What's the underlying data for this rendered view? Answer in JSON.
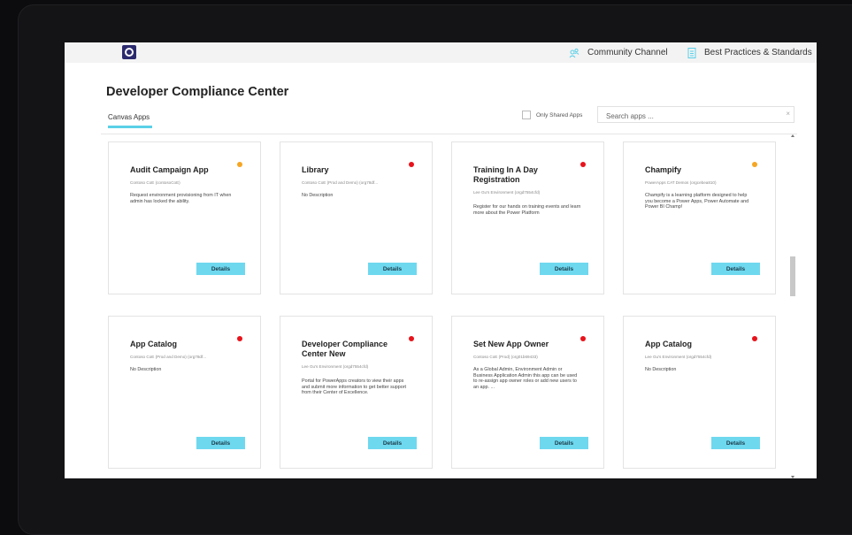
{
  "header": {
    "community_label": "Community Channel",
    "best_practices_label": "Best Practices & Standards"
  },
  "page": {
    "title": "Developer Compliance Center"
  },
  "tabs": [
    {
      "label": "Canvas Apps",
      "selected": true
    }
  ],
  "filters": {
    "only_shared_label": "Only Shared Apps",
    "only_shared_checked": false
  },
  "search": {
    "placeholder": "Search apps ...",
    "clear": "×"
  },
  "colors": {
    "accent": "#6ed8ef",
    "status_orange": "#f5a623",
    "status_red": "#e8131b"
  },
  "cards": [
    {
      "title": "Audit Campaign App",
      "environment": "Contoso CoE (contosoCoE)",
      "description": "Request environment provisioning from IT when admin has locked the ability.",
      "status": "orange",
      "details_label": "Details"
    },
    {
      "title": "Library",
      "environment": "Contoso CoE (Prod and Demo) (org78df...",
      "description": "No Description",
      "status": "red",
      "details_label": "Details"
    },
    {
      "title": "Training In A Day Registration",
      "environment": "Lee Gu's Environment (orgd7554cfd)",
      "description": "Register for our hands on training events and learn more about the Power Platform",
      "status": "red",
      "details_label": "Details"
    },
    {
      "title": "Champify",
      "environment": "PowerApps CAT Demos (orgcebea810)",
      "description": "Champify is a learning platform designed to help you become a Power Apps, Power Automate and Power BI Champ!",
      "status": "orange",
      "details_label": "Details"
    },
    {
      "title": "App Catalog",
      "environment": "Contoso CoE (Prod and Demo) (org78df...",
      "description": "No Description",
      "status": "red",
      "details_label": "Details"
    },
    {
      "title": "Developer Compliance Center New",
      "environment": "Lee Gu's Environment (orgd7554cfd)",
      "description": "Portal for PowerApps creators to view their apps and submit more information to get better support from their Center of Excellence.",
      "status": "red",
      "details_label": "Details"
    },
    {
      "title": "Set New App Owner",
      "environment": "Contoso CoE (Prod) (org01b69433)",
      "description": "As a Global Admin, Environment Admin or Business Application Admin this app can be used to re-assign app owner roles or add new users to an app. ...",
      "status": "red",
      "details_label": "Details"
    },
    {
      "title": "App Catalog",
      "environment": "Lee Gu's Environment (orgd7554cfd)",
      "description": "No Description",
      "status": "red",
      "details_label": "Details"
    }
  ]
}
